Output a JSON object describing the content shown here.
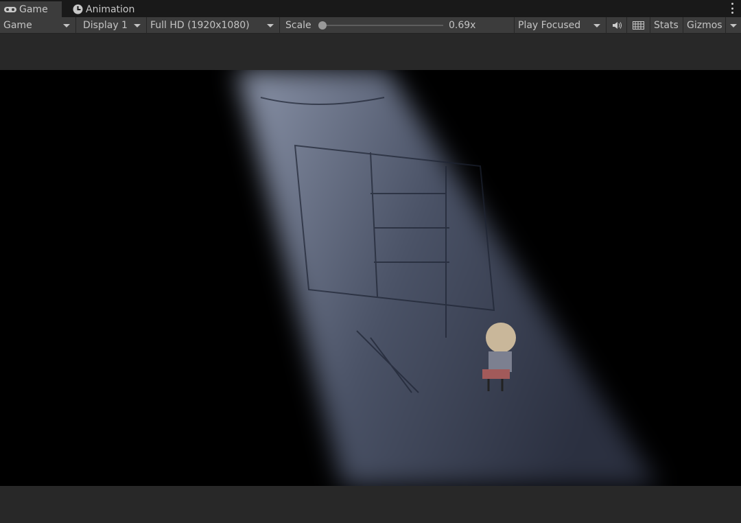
{
  "tabs": [
    {
      "label": "Game",
      "icon": "gamepad-icon"
    },
    {
      "label": "Animation",
      "icon": "clock-icon"
    }
  ],
  "toolbar": {
    "view_mode": "Game",
    "display": "Display 1",
    "resolution": "Full HD (1920x1080)",
    "scale_label": "Scale",
    "scale_value": "0.69x",
    "scale_fraction": 0.0,
    "play_mode": "Play Focused",
    "stats": "Stats",
    "gizmos": "Gizmos"
  },
  "colors": {
    "panel": "#3c3c3c",
    "tabbar": "#191919",
    "game_bg": "#000000"
  }
}
